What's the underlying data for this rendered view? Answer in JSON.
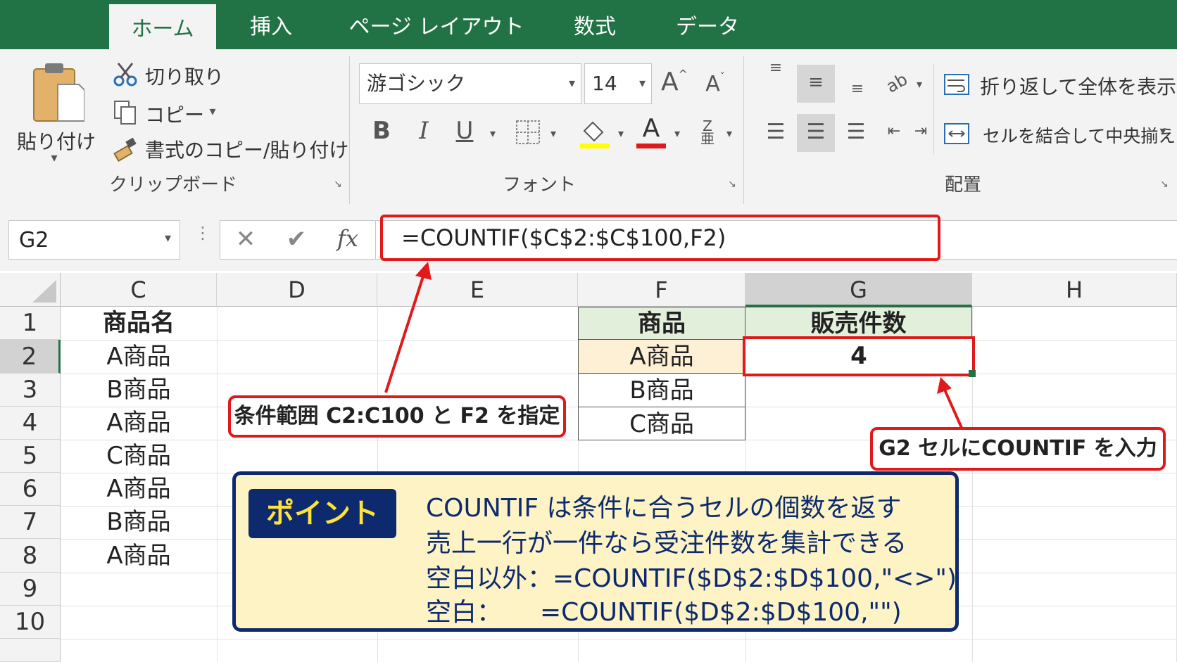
{
  "tabs": [
    {
      "label": "ホーム",
      "active": true
    },
    {
      "label": "挿入",
      "active": false
    },
    {
      "label": "ページ レイアウト",
      "active": false
    },
    {
      "label": "数式",
      "active": false
    },
    {
      "label": "データ",
      "active": false
    }
  ],
  "clipboard": {
    "paste_label": "貼り付け",
    "cut_label": "切り取り",
    "copy_label": "コピー",
    "format_painter_label": "書式のコピー/貼り付け",
    "group_label": "クリップボード"
  },
  "font": {
    "family": "游ゴシック",
    "size": "14",
    "group_label": "フォント",
    "highlight_color": "#ffff00",
    "font_color": "#e0191b"
  },
  "alignment": {
    "wrap_label": "折り返して全体を表示する",
    "merge_label": "セルを結合して中央揃え",
    "group_label": "配置"
  },
  "formula_bar": {
    "name_box": "G2",
    "fx": "fx",
    "formula": "=COUNTIF($C$2:$C$100,F2)"
  },
  "columns": [
    "C",
    "D",
    "E",
    "F",
    "G",
    "H"
  ],
  "rows": [
    "1",
    "2",
    "3",
    "4",
    "5",
    "6",
    "7",
    "8",
    "9",
    "10"
  ],
  "column_c": [
    "商品名",
    "A商品",
    "B商品",
    "A商品",
    "C商品",
    "A商品",
    "B商品",
    "A商品"
  ],
  "table": {
    "header_product": "商品",
    "header_count": "販売件数",
    "products": [
      "A商品",
      "B商品",
      "C商品"
    ],
    "result": "4",
    "header_color": "#e2efda",
    "highlight_color": "#fdf0d5"
  },
  "callouts": {
    "range": "条件範囲 C2:C100 と F2 を指定",
    "input": "G2 セルにCOUNTIF を入力",
    "accent": "#e0191b"
  },
  "point": {
    "badge": "ポイント",
    "lines": [
      "COUNTIF は条件に合うセルの個数を返す",
      "売上一行が一件なら受注件数を集計できる",
      "空白以外：=COUNTIF($D$2:$D$100,\"<>\")",
      "空白：　　=COUNTIF($D$2:$D$100,\"\")"
    ],
    "bg": "#fdf3c4",
    "border": "#0d2a6e"
  }
}
